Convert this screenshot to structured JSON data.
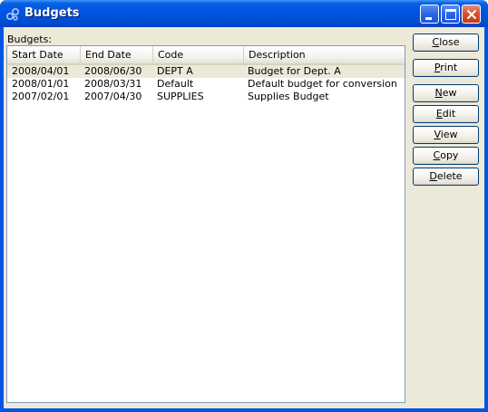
{
  "window": {
    "title": "Budgets"
  },
  "list": {
    "label": "Budgets:",
    "columns": [
      "Start Date",
      "End Date",
      "Code",
      "Description"
    ],
    "rows": [
      {
        "start": "2008/04/01",
        "end": "2008/06/30",
        "code": "DEPT A",
        "description": "Budget for Dept. A",
        "selected": true
      },
      {
        "start": "2008/01/01",
        "end": "2008/03/31",
        "code": "Default",
        "description": "Default budget for conversion",
        "selected": false
      },
      {
        "start": "2007/02/01",
        "end": "2007/04/30",
        "code": "SUPPLIES",
        "description": "Supplies Budget",
        "selected": false
      }
    ]
  },
  "buttons": {
    "close": "Close",
    "print": "Print",
    "new": "New",
    "edit": "Edit",
    "view": "View",
    "copy": "Copy",
    "delete": "Delete"
  },
  "colors": {
    "titlebar": "#0055e5",
    "face": "#ece9d8",
    "border": "#7f9db9"
  }
}
